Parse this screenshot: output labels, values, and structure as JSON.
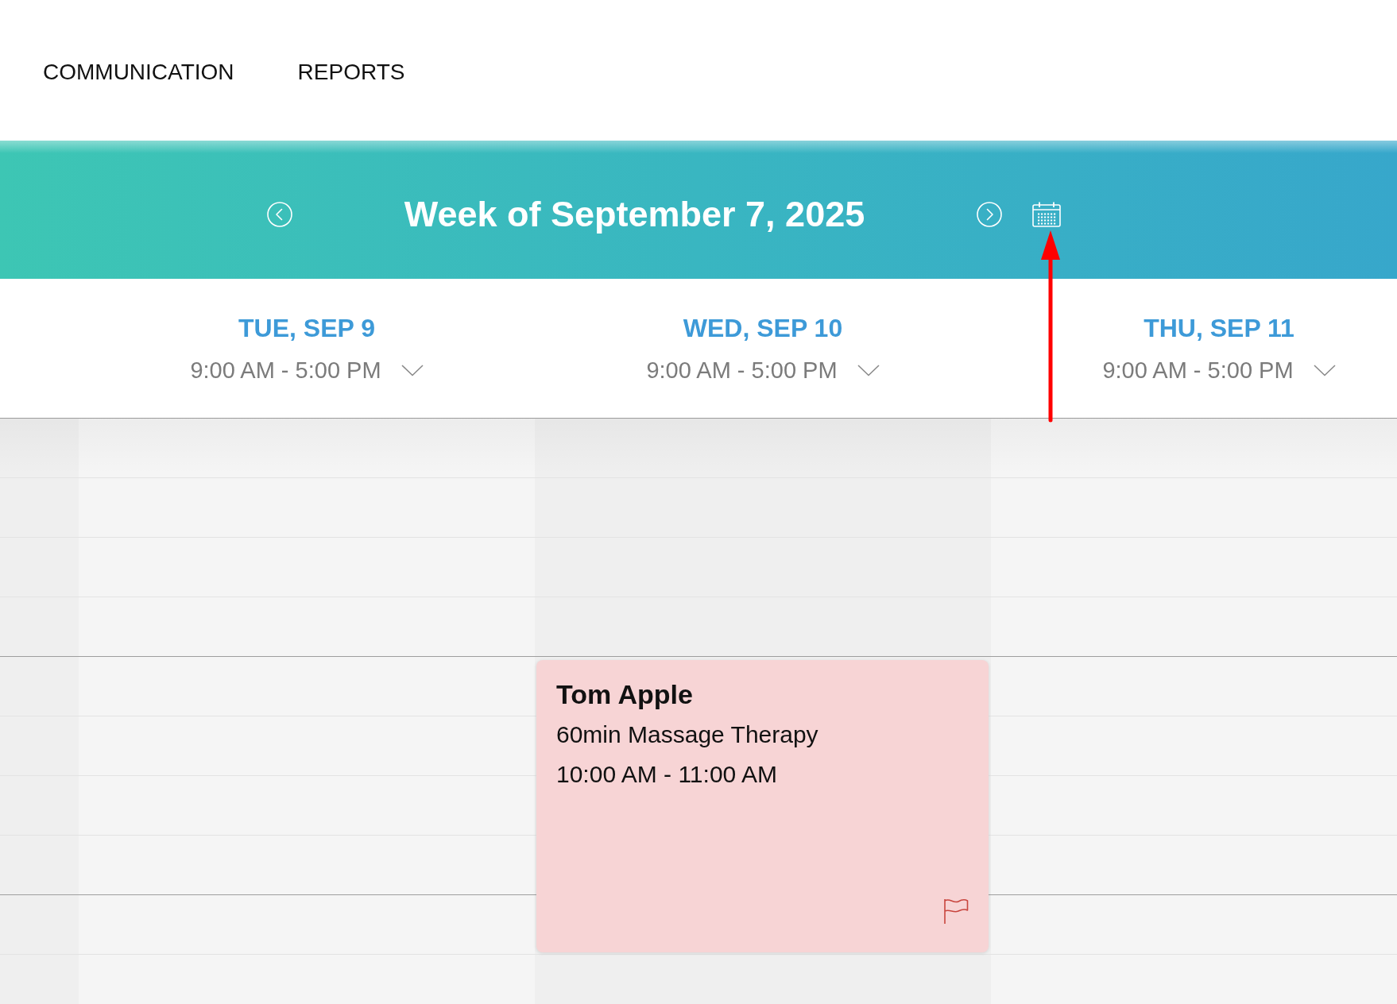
{
  "nav": {
    "items": [
      {
        "label": "COMMUNICATION"
      },
      {
        "label": "REPORTS"
      }
    ]
  },
  "week_header": {
    "title": "Week of September 7, 2025"
  },
  "days": [
    {
      "label": "TUE, SEP 9",
      "hours": "9:00 AM - 5:00 PM"
    },
    {
      "label": "WED, SEP 10",
      "hours": "9:00 AM - 5:00 PM",
      "appointments": [
        {
          "client": "Tom Apple",
          "service": "60min Massage Therapy",
          "time": "10:00 AM - 11:00 AM",
          "flagged": true
        }
      ]
    },
    {
      "label": "THU, SEP 11",
      "hours": "9:00 AM - 5:00 PM"
    }
  ],
  "annotations": [
    {
      "kind": "arrow"
    }
  ]
}
